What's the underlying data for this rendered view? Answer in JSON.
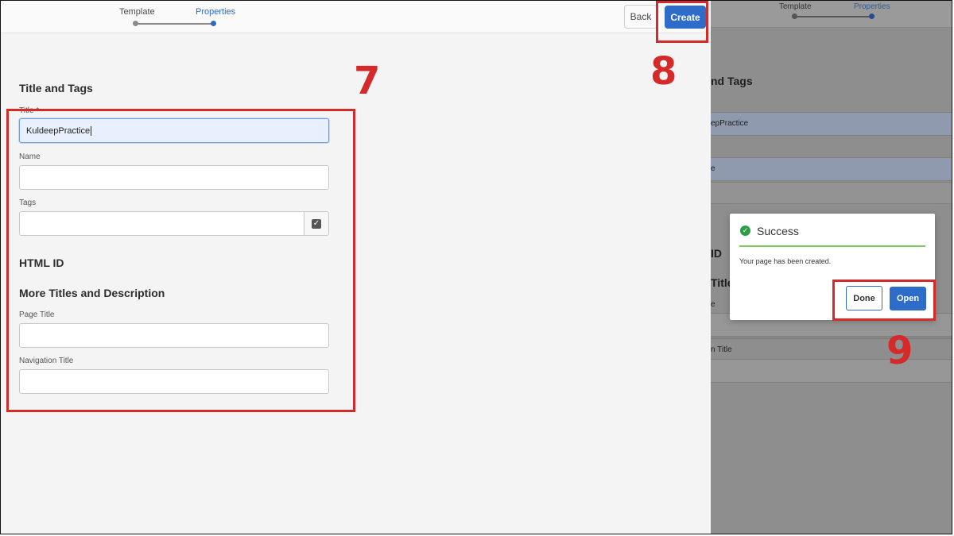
{
  "left": {
    "wizard": {
      "steps": [
        "Template",
        "Properties"
      ],
      "active_step": "Properties"
    },
    "buttons": {
      "back": "Back",
      "create": "Create"
    },
    "sections": {
      "title_tags": "Title and Tags",
      "html_id": "HTML ID",
      "more": "More Titles and Description"
    },
    "fields": {
      "title_label": "Title *",
      "title_value": "KuldeepPractice",
      "name_label": "Name",
      "tags_label": "Tags",
      "page_title_label": "Page Title",
      "nav_title_label": "Navigation Title"
    }
  },
  "right": {
    "wizard": {
      "steps": [
        "Template",
        "Properties"
      ]
    },
    "bg": {
      "heading1": "nd Tags",
      "field1": "epPractice",
      "field2": "e",
      "heading2": "ID",
      "heading3": "Title",
      "lbl1": "e",
      "lbl2": "n Title"
    },
    "dialog": {
      "title": "Success",
      "message": "Your page has been created.",
      "done": "Done",
      "open": "Open"
    }
  },
  "annotations": {
    "n7": "7",
    "n8": "8",
    "n9": "9"
  },
  "colors": {
    "accent": "#2d6cc9",
    "annotation": "#d42a2a",
    "success": "#2d9d48"
  }
}
